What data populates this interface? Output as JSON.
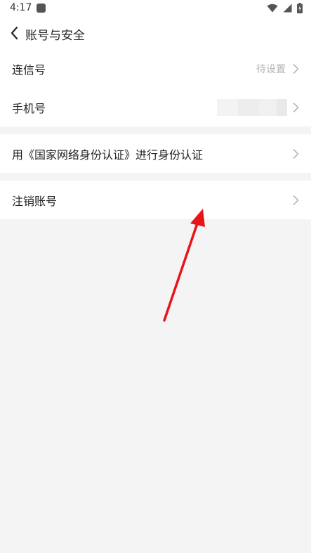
{
  "status_bar": {
    "time": "4:17"
  },
  "header": {
    "title": "账号与安全"
  },
  "rows": {
    "lianxin_id": {
      "label": "连信号",
      "value": "待设置"
    },
    "phone": {
      "label": "手机号"
    },
    "id_verify": {
      "label": "用《国家网络身份认证》进行身份认证"
    },
    "cancel_account": {
      "label": "注销账号"
    }
  },
  "colors": {
    "annotation_arrow": "#e8141b",
    "background": "#f4f4f4",
    "row_background": "#ffffff",
    "secondary_text": "#b3b3b3"
  },
  "icons": {
    "back": "chevron-left-icon",
    "row_arrow": "chevron-right-icon",
    "wifi": "wifi-icon",
    "signal": "signal-icon",
    "battery": "battery-icon"
  }
}
